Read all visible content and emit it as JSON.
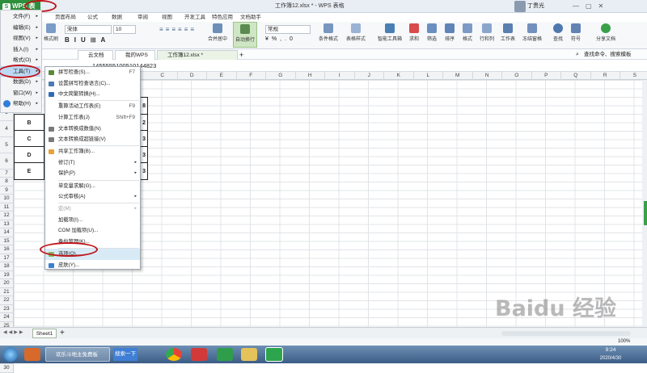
{
  "app": {
    "logo_text": "WPS 表格",
    "logo_letter": "S",
    "document_title": "工作簿12.xlsx * - WPS 表格",
    "user_name": "丁贵光",
    "accent_color": "#2d8f3c"
  },
  "ribbon_tabs": [
    "页面布局",
    "公式",
    "数据",
    "审阅",
    "视图",
    "开发工具",
    "特色应用",
    "文档助手"
  ],
  "ribbon": {
    "font_name": "宋体",
    "font_size": "10",
    "number_format": "常规",
    "buttons": {
      "format_painter": "格式刷",
      "merge_center": "合并居中",
      "wrap_text": "自动换行",
      "cond_format": "条件格式",
      "table_style": "表格样式",
      "smart_toolbox": "智能工具箱",
      "sum": "求和",
      "filter": "筛选",
      "sort": "排序",
      "format": "格式",
      "rows_cols": "行和列",
      "worksheet": "工作表",
      "freeze": "冻结窗格",
      "find": "查找",
      "symbol": "符号",
      "share": "分享文档"
    }
  },
  "doc_tabs": {
    "cloud": "云文档",
    "my_wps": "我的WPS",
    "workbook": "工作簿12.xlsx *",
    "add": "+"
  },
  "search_label": "查找命令、搜索模板",
  "formula_bar_value": "1455555100510144823",
  "left_menu": [
    {
      "label": "文件(F)",
      "active": false
    },
    {
      "label": "编辑(E)",
      "active": false
    },
    {
      "label": "视图(V)",
      "active": false
    },
    {
      "label": "插入(I)",
      "active": false
    },
    {
      "label": "格式(O)",
      "active": false
    },
    {
      "label": "工具(T)",
      "active": true
    },
    {
      "label": "数据(D)",
      "active": false
    },
    {
      "label": "窗口(W)",
      "active": false
    },
    {
      "label": "帮助(H)",
      "active": false
    }
  ],
  "tools_menu": [
    {
      "label": "拼写检查(S)...",
      "shortcut": "F7",
      "disabled": false,
      "submenu": false
    },
    {
      "label": "设置拼写检查语言(C)...",
      "shortcut": "",
      "disabled": false,
      "submenu": false
    },
    {
      "label": "中文简繁转换(H)...",
      "shortcut": "",
      "disabled": false,
      "submenu": false
    },
    {
      "label": "重算活动工作表(E)",
      "shortcut": "F9",
      "disabled": false,
      "submenu": false
    },
    {
      "label": "计算工作表(J)",
      "shortcut": "Shift+F9",
      "disabled": false,
      "submenu": false
    },
    {
      "label": "文本转换成数值(N)",
      "shortcut": "",
      "disabled": false,
      "submenu": false
    },
    {
      "label": "文本转换成超链接(V)",
      "shortcut": "",
      "disabled": false,
      "submenu": false
    },
    {
      "label": "共享工作簿(B)...",
      "shortcut": "",
      "disabled": false,
      "submenu": false
    },
    {
      "label": "修订(T)",
      "shortcut": "",
      "disabled": false,
      "submenu": true
    },
    {
      "label": "保护(P)",
      "shortcut": "",
      "disabled": false,
      "submenu": true
    },
    {
      "label": "单变量求解(G)...",
      "shortcut": "",
      "disabled": false,
      "submenu": false
    },
    {
      "label": "公式审核(A)",
      "shortcut": "",
      "disabled": false,
      "submenu": true
    },
    {
      "label": "宏(M)",
      "shortcut": "",
      "disabled": true,
      "submenu": true
    },
    {
      "label": "加载项(I)...",
      "shortcut": "",
      "disabled": false,
      "submenu": false
    },
    {
      "label": "COM 加载项(U)...",
      "shortcut": "",
      "disabled": false,
      "submenu": false
    },
    {
      "label": "备份管理(K)...",
      "shortcut": "",
      "disabled": false,
      "submenu": false
    },
    {
      "label": "选项(O)...",
      "shortcut": "",
      "disabled": false,
      "submenu": false,
      "highlighted": true
    },
    {
      "label": "皮肤(Y)...",
      "shortcut": "",
      "disabled": false,
      "submenu": false
    }
  ],
  "columns": [
    "C",
    "D",
    "E",
    "F",
    "G",
    "H",
    "I",
    "J",
    "K",
    "L",
    "M",
    "N",
    "O",
    "P",
    "Q",
    "R",
    "S"
  ],
  "rows": [
    "1",
    "2",
    "3",
    "4",
    "5",
    "6",
    "7",
    "8",
    "9",
    "10",
    "11",
    "12",
    "13",
    "14",
    "15",
    "16",
    "17",
    "18",
    "19",
    "20",
    "21",
    "22",
    "23",
    "24",
    "25",
    "26",
    "27",
    "28",
    "29",
    "30"
  ],
  "cells": {
    "a3": "B",
    "a4": "C",
    "a5": "D",
    "a6": "E",
    "b2": "8",
    "b3": "2",
    "b4": "3",
    "b5": "3",
    "b6": "3"
  },
  "sheet_tab": "Sheet1",
  "status": {
    "zoom": "100%"
  },
  "taskbar": {
    "ie_label": "欢乐斗地主免费板",
    "search_label": "搜索一下",
    "time": "9:24",
    "date": "2020/4/30"
  },
  "watermark": "Baidu 经验"
}
